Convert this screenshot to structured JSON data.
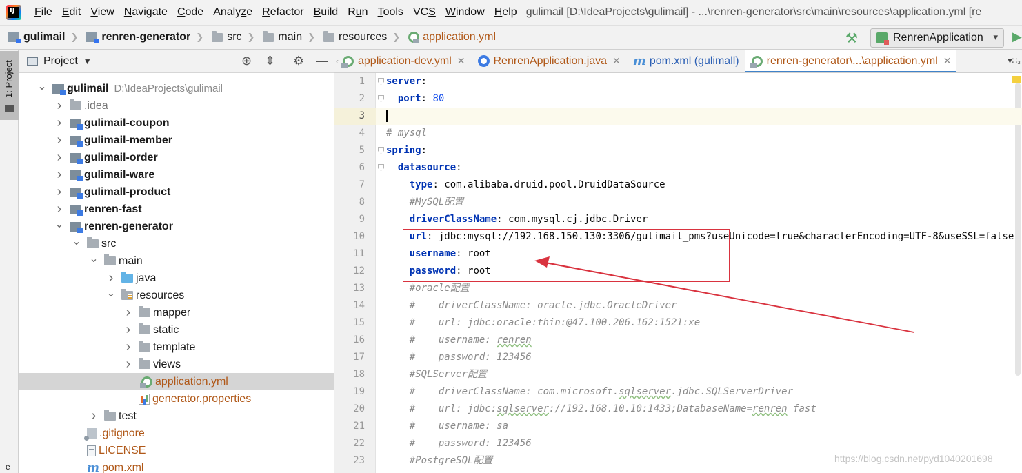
{
  "menubar": {
    "items": [
      "File",
      "Edit",
      "View",
      "Navigate",
      "Code",
      "Analyze",
      "Refactor",
      "Build",
      "Run",
      "Tools",
      "VCS",
      "Window",
      "Help"
    ],
    "mnemonics": [
      "F",
      "E",
      "V",
      "N",
      "C",
      "z",
      "R",
      "B",
      "u",
      "T",
      "S",
      "W",
      "H"
    ],
    "window_title": "gulimail [D:\\IdeaProjects\\gulimail] - ...\\renren-generator\\src\\main\\resources\\application.yml [re"
  },
  "breadcrumb": {
    "items": [
      "gulimail",
      "renren-generator",
      "src",
      "main",
      "resources",
      "application.yml"
    ]
  },
  "run_config": {
    "label": "RenrenApplication"
  },
  "tool_stripe": {
    "project_tab": "1: Project",
    "bottom_glyph": "e"
  },
  "project_panel": {
    "title": "Project",
    "tree": [
      {
        "label": "gulimail",
        "extra": "D:\\IdeaProjects\\gulimail",
        "depth": 0,
        "chev": "open",
        "icon": "module",
        "style": "bold"
      },
      {
        "label": ".idea",
        "depth": 1,
        "chev": "closed",
        "icon": "folder",
        "style": "gray"
      },
      {
        "label": "gulimail-coupon",
        "depth": 1,
        "chev": "closed",
        "icon": "module",
        "style": "bold"
      },
      {
        "label": "gulimail-member",
        "depth": 1,
        "chev": "closed",
        "icon": "module",
        "style": "bold"
      },
      {
        "label": "gulimail-order",
        "depth": 1,
        "chev": "closed",
        "icon": "module",
        "style": "bold"
      },
      {
        "label": "gulimail-ware",
        "depth": 1,
        "chev": "closed",
        "icon": "module",
        "style": "bold"
      },
      {
        "label": "gulimall-product",
        "depth": 1,
        "chev": "closed",
        "icon": "module",
        "style": "bold"
      },
      {
        "label": "renren-fast",
        "depth": 1,
        "chev": "closed",
        "icon": "module",
        "style": "bold"
      },
      {
        "label": "renren-generator",
        "depth": 1,
        "chev": "open",
        "icon": "module",
        "style": "bold"
      },
      {
        "label": "src",
        "depth": 2,
        "chev": "open",
        "icon": "folder",
        "style": ""
      },
      {
        "label": "main",
        "depth": 3,
        "chev": "open",
        "icon": "folder",
        "style": ""
      },
      {
        "label": "java",
        "depth": 4,
        "chev": "closed",
        "icon": "folder-blue",
        "style": ""
      },
      {
        "label": "resources",
        "depth": 4,
        "chev": "open",
        "icon": "folder-res",
        "style": ""
      },
      {
        "label": "mapper",
        "depth": 5,
        "chev": "closed",
        "icon": "folder",
        "style": ""
      },
      {
        "label": "static",
        "depth": 5,
        "chev": "closed",
        "icon": "folder",
        "style": ""
      },
      {
        "label": "template",
        "depth": 5,
        "chev": "closed",
        "icon": "folder",
        "style": ""
      },
      {
        "label": "views",
        "depth": 5,
        "chev": "closed",
        "icon": "folder",
        "style": ""
      },
      {
        "label": "application.yml",
        "depth": 5,
        "chev": "none",
        "icon": "yml",
        "style": "orange",
        "selected": true
      },
      {
        "label": "generator.properties",
        "depth": 5,
        "chev": "none",
        "icon": "props",
        "style": "orange"
      },
      {
        "label": "test",
        "depth": 3,
        "chev": "closed",
        "icon": "folder",
        "style": ""
      },
      {
        "label": ".gitignore",
        "depth": 2,
        "chev": "none",
        "icon": "gitfile",
        "style": "orange"
      },
      {
        "label": "LICENSE",
        "depth": 2,
        "chev": "none",
        "icon": "textfile",
        "style": "orange"
      },
      {
        "label": "pom.xml",
        "depth": 2,
        "chev": "none",
        "icon": "maven",
        "style": "orange"
      }
    ]
  },
  "editor_tabs": [
    {
      "label": "application-dev.yml",
      "icon": "yml",
      "color": "orange",
      "active": false
    },
    {
      "label": "RenrenApplication.java",
      "icon": "java",
      "color": "orange",
      "active": false
    },
    {
      "label": "pom.xml (gulimall)",
      "icon": "maven",
      "color": "blue",
      "active": false
    },
    {
      "label": "renren-generator\\...\\application.yml",
      "icon": "yml",
      "color": "orange",
      "active": true
    }
  ],
  "tabs_overflow": "▾∷₃",
  "code_lines": [
    {
      "n": "1",
      "parts": [
        [
          "k",
          "server"
        ],
        [
          "",
          "："
        ]
      ],
      "fold": true
    },
    {
      "n": "2",
      "parts": [
        [
          "",
          "  "
        ],
        [
          "k",
          "port"
        ],
        [
          "",
          ": "
        ],
        [
          "n",
          "80"
        ]
      ],
      "fold": true
    },
    {
      "n": "3",
      "parts": [],
      "current": true
    },
    {
      "n": "4",
      "parts": [
        [
          "c",
          "# mysql"
        ]
      ]
    },
    {
      "n": "5",
      "parts": [
        [
          "k",
          "spring"
        ],
        [
          "",
          ":"
        ]
      ],
      "fold": true
    },
    {
      "n": "6",
      "parts": [
        [
          "",
          "  "
        ],
        [
          "k",
          "datasource"
        ],
        [
          "",
          ":"
        ]
      ],
      "fold": true
    },
    {
      "n": "7",
      "parts": [
        [
          "",
          "    "
        ],
        [
          "k",
          "type"
        ],
        [
          "",
          ": com.alibaba.druid.pool.DruidDataSource"
        ]
      ]
    },
    {
      "n": "8",
      "parts": [
        [
          "",
          "    "
        ],
        [
          "c",
          "#MySQL配置"
        ]
      ]
    },
    {
      "n": "9",
      "parts": [
        [
          "",
          "    "
        ],
        [
          "k",
          "driverClassName"
        ],
        [
          "",
          ": com.mysql.cj.jdbc.Driver"
        ]
      ]
    },
    {
      "n": "10",
      "parts": [
        [
          "",
          "    "
        ],
        [
          "k",
          "url"
        ],
        [
          "",
          ": jdbc:mysql://192.168.150.130:3306/gulimail_pms?useUnicode=true&characterEncoding=UTF-8&useSSL=false"
        ]
      ]
    },
    {
      "n": "11",
      "parts": [
        [
          "",
          "    "
        ],
        [
          "k",
          "username"
        ],
        [
          "",
          ": root"
        ]
      ]
    },
    {
      "n": "12",
      "parts": [
        [
          "",
          "    "
        ],
        [
          "k",
          "password"
        ],
        [
          "",
          ": root"
        ]
      ]
    },
    {
      "n": "13",
      "parts": [
        [
          "",
          "    "
        ],
        [
          "c",
          "#oracle配置"
        ]
      ]
    },
    {
      "n": "14",
      "parts": [
        [
          "",
          "    "
        ],
        [
          "c",
          "#    driverClassName: oracle.jdbc.OracleDriver"
        ]
      ]
    },
    {
      "n": "15",
      "parts": [
        [
          "",
          "    "
        ],
        [
          "c",
          "#    url: jdbc:oracle:thin:@47.100.206.162:1521:xe"
        ]
      ]
    },
    {
      "n": "16",
      "parts": [
        [
          "",
          "    "
        ],
        [
          "c",
          "#    username: "
        ],
        [
          "cs",
          "renren"
        ]
      ]
    },
    {
      "n": "17",
      "parts": [
        [
          "",
          "    "
        ],
        [
          "c",
          "#    password: 123456"
        ]
      ]
    },
    {
      "n": "18",
      "parts": [
        [
          "",
          "    "
        ],
        [
          "c",
          "#SQLServer配置"
        ]
      ]
    },
    {
      "n": "19",
      "parts": [
        [
          "",
          "    "
        ],
        [
          "c",
          "#    driverClassName: com.microsoft."
        ],
        [
          "cs",
          "sqlserver"
        ],
        [
          "c",
          ".jdbc.SQLServerDriver"
        ]
      ]
    },
    {
      "n": "20",
      "parts": [
        [
          "",
          "    "
        ],
        [
          "c",
          "#    url: jdbc:"
        ],
        [
          "cs",
          "sqlserver"
        ],
        [
          "c",
          "://192.168.10.10:1433;DatabaseName="
        ],
        [
          "cs",
          "renren"
        ],
        [
          "c",
          "_fast"
        ]
      ]
    },
    {
      "n": "21",
      "parts": [
        [
          "",
          "    "
        ],
        [
          "c",
          "#    username: sa"
        ]
      ]
    },
    {
      "n": "22",
      "parts": [
        [
          "",
          "    "
        ],
        [
          "c",
          "#    password: 123456"
        ]
      ]
    },
    {
      "n": "23",
      "parts": [
        [
          "",
          "    "
        ],
        [
          "c",
          "#PostgreSQL配置"
        ]
      ]
    }
  ],
  "watermark": "https://blog.csdn.net/pyd1040201698",
  "colors": {
    "keyword": "#0033b3",
    "number": "#1750eb",
    "comment": "#8c8c8c",
    "annotation": "#d9333f",
    "selection": "#d5d5d5"
  }
}
